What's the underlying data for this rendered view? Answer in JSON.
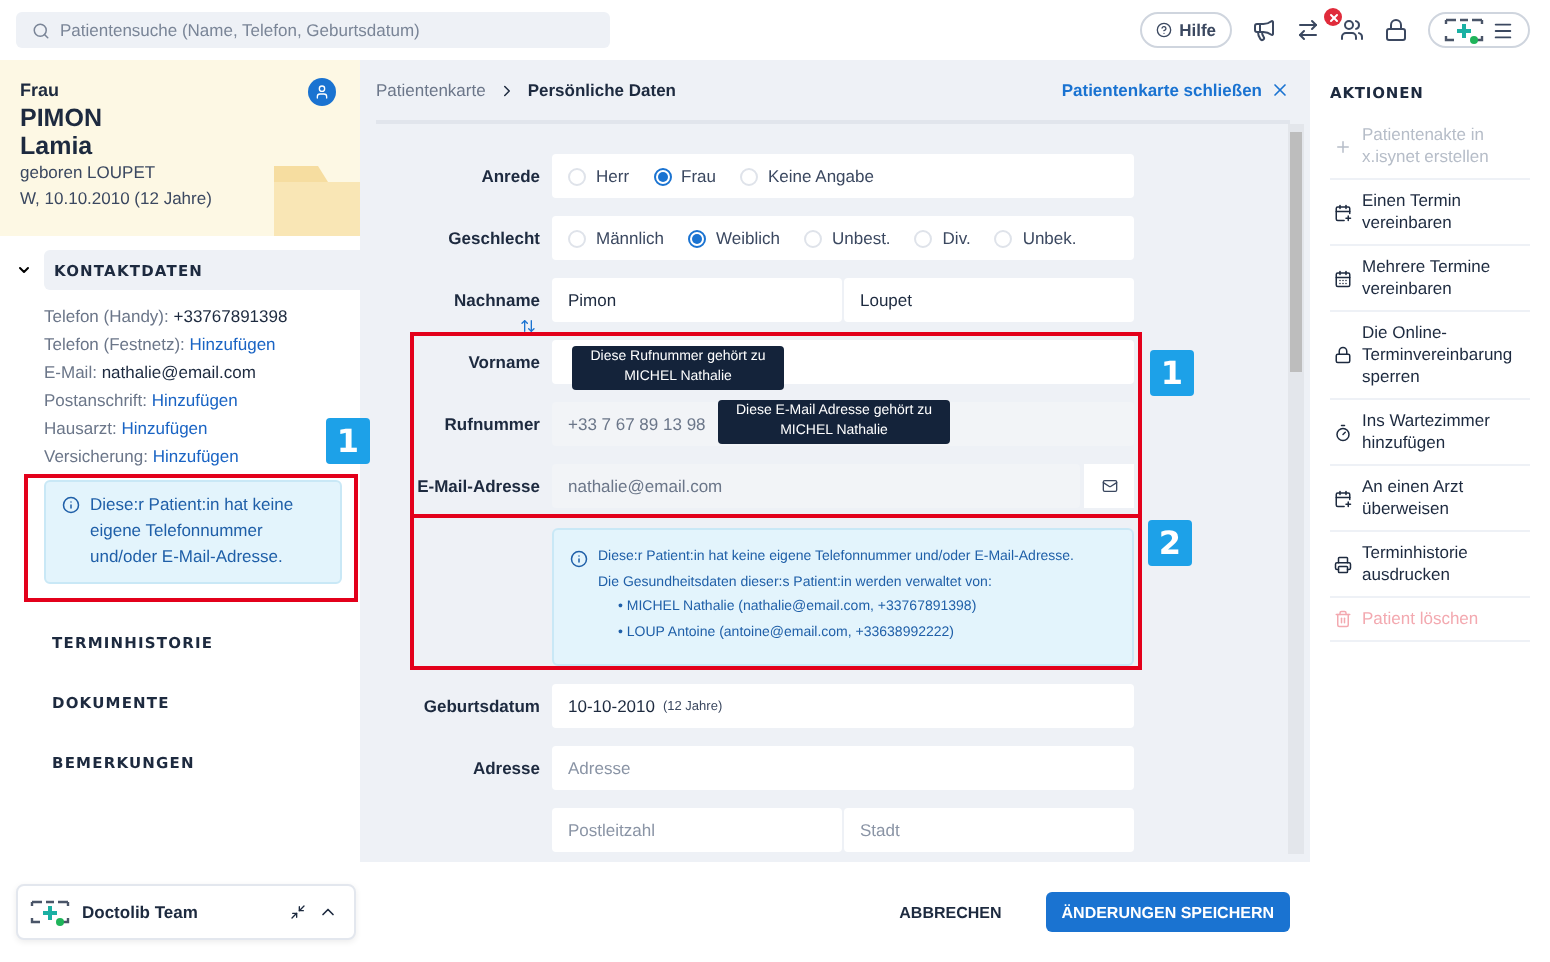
{
  "search": {
    "placeholder": "Patientensuche (Name, Telefon, Geburtsdatum)"
  },
  "help": "Hilfe",
  "patient": {
    "salutation": "Frau",
    "last_name": "PIMON",
    "first_name": "Lamia",
    "birth_name": "geboren LOUPET",
    "birth": "W, 10.10.2010 (12 Jahre)"
  },
  "contact": {
    "title": "KONTAKTDATEN",
    "expanded": true,
    "items": [
      {
        "label": "Telefon (Handy):",
        "value": "+33767891398",
        "kind": "value"
      },
      {
        "label": "Telefon (Festnetz):",
        "value": "Hinzufügen",
        "kind": "link"
      },
      {
        "label": "E-Mail:",
        "value": "nathalie@email.com",
        "kind": "value"
      },
      {
        "label": "Postanschrift:",
        "value": "Hinzufügen",
        "kind": "link"
      },
      {
        "label": "Hausarzt:",
        "value": "Hinzufügen",
        "kind": "link"
      },
      {
        "label": "Versicherung:",
        "value": "Hinzufügen",
        "kind": "link"
      }
    ],
    "notice": "Diese:r Patient:in hat keine eigene Telefonnummer und/oder E-Mail-Adresse."
  },
  "sections": [
    "TERMINHISTORIE",
    "DOKUMENTE",
    "BEMERKUNGEN"
  ],
  "team": {
    "name": "Doctolib Team"
  },
  "breadcrumb": [
    "Patientenkarte",
    "Persönliche Daten"
  ],
  "close": "Patientenkarte schließen",
  "rows": [
    {
      "kind": "radio",
      "label": "Anrede",
      "options": [
        {
          "label": "Herr",
          "selected": false
        },
        {
          "label": "Frau",
          "selected": true
        },
        {
          "label": "Keine Angabe",
          "selected": false
        }
      ]
    },
    {
      "kind": "radio",
      "label": "Geschlecht",
      "options": [
        {
          "label": "Männlich",
          "selected": false
        },
        {
          "label": "Weiblich",
          "selected": true
        },
        {
          "label": "Unbest.",
          "selected": false
        },
        {
          "label": "Div.",
          "selected": false
        },
        {
          "label": "Unbek.",
          "selected": false
        }
      ]
    },
    {
      "kind": "fields",
      "label": "Nachname",
      "swap": true,
      "fields": [
        {
          "value": "Pimon",
          "disabled": false
        },
        {
          "value": "Loupet",
          "disabled": false
        }
      ]
    },
    {
      "kind": "blank",
      "label": "Vorname"
    },
    {
      "kind": "fields",
      "label": "Rufnummer",
      "fields": [
        {
          "value": "+33 7 67 89 13 98",
          "disabled": true
        }
      ]
    },
    {
      "kind": "email",
      "label": "E-Mail-Adresse",
      "value": "nathalie@email.com",
      "disabled": true
    },
    {
      "kind": "info",
      "lines": [
        "Diese:r Patient:in hat keine eigene Telefonnummer und/oder E-Mail-Adresse.",
        "Die Gesundheitsdaten dieser:s Patient:in werden verwaltet von:"
      ],
      "items": [
        {
          "marker": "•",
          "text": "MICHEL Nathalie (nathalie@email.com, +33767891398)"
        },
        {
          "marker": "•",
          "text": "LOUP Antoine (antoine@email.com, +33638992222)"
        }
      ]
    },
    {
      "kind": "date",
      "label": "Geburtsdatum",
      "value": "10-10-2010",
      "note": "(12 Jahre)"
    },
    {
      "kind": "fields",
      "label": "Adresse",
      "fields": [
        {
          "placeholder": "Adresse",
          "disabled": false
        }
      ]
    },
    {
      "kind": "fields",
      "fields": [
        {
          "placeholder": "Postleitzahl",
          "disabled": false
        },
        {
          "placeholder": "Stadt",
          "disabled": false
        }
      ]
    }
  ],
  "tooltips": [
    "Diese Rufnummer gehört zu MICHEL Nathalie",
    "Diese E-Mail Adresse gehört zu MICHEL Nathalie"
  ],
  "footer": {
    "cancel": "ABBRECHEN",
    "save": "ÄNDERUNGEN SPEICHERN"
  },
  "actions": {
    "title": "AKTIONEN",
    "items": [
      {
        "label": "Patientenakte in x.isynet erstellen",
        "kind": "plus",
        "disabled": true
      },
      {
        "label": "Einen Termin vereinbaren",
        "kind": "calendar",
        "disabled": false
      },
      {
        "label": "Mehrere Termine vereinbaren",
        "kind": "calendar-full",
        "disabled": false
      },
      {
        "label": "Die Online-Terminvereinbarung sperren",
        "kind": "lock",
        "disabled": false
      },
      {
        "label": "Ins Wartezimmer hinzufügen",
        "kind": "timer",
        "disabled": false
      },
      {
        "label": "An einen Arzt überweisen",
        "kind": "calendar",
        "disabled": false
      },
      {
        "label": "Terminhistorie ausdrucken",
        "kind": "print",
        "disabled": false
      },
      {
        "label": "Patient löschen",
        "kind": "delete",
        "disabled": true
      }
    ]
  },
  "annotations": [
    "1",
    "1",
    "2"
  ]
}
